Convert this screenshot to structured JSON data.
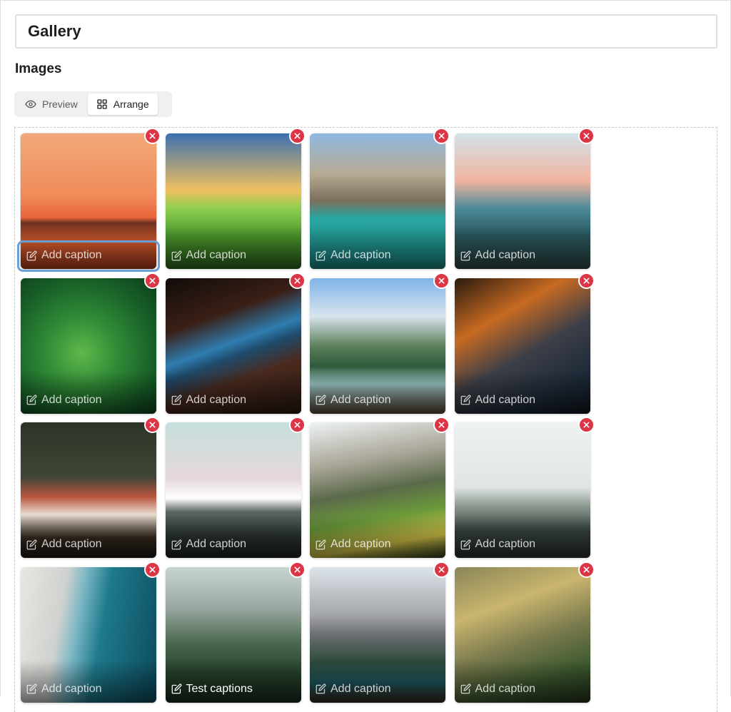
{
  "gallery": {
    "title": "Gallery",
    "section_heading": "Images"
  },
  "mode_toggle": {
    "preview_label": "Preview",
    "arrange_label": "Arrange",
    "active": "arrange"
  },
  "colors": {
    "remove": "#dc3545",
    "focus_ring": "#6aa0d8"
  },
  "images": [
    {
      "caption": "",
      "placeholder": "Add caption",
      "selected": true,
      "bg": "linear-gradient(180deg,#f2a87a 0%,#f08c5a 45%,#e9653b 62%,#6a2f1f 66%,#e0602e 80%,#b04020 100%)"
    },
    {
      "caption": "",
      "placeholder": "Add caption",
      "bg": "linear-gradient(180deg,#3c6fb0 0%,#f0c060 42%,#8fcf50 55%,#4d9a2e 75%,#2f6b1e 100%)"
    },
    {
      "caption": "",
      "placeholder": "Add caption",
      "bg": "linear-gradient(180deg,#8fb8e0 0%,#b7aa93 30%,#7a6e5c 50%,#2aa6a0 62%,#1b8a86 100%)"
    },
    {
      "caption": "",
      "placeholder": "Add caption",
      "bg": "linear-gradient(180deg,#d3e2ea 0%,#f2b49e 35%,#4d8a9a 55%,#2a5a60 75%,#2f4848 100%)"
    },
    {
      "caption": "",
      "placeholder": "Add caption",
      "bg": "radial-gradient(circle at 45% 55%,#5fb84a 0%,#2f8a36 35%,#175e28 70%,#0d3d1a 100%)"
    },
    {
      "caption": "",
      "placeholder": "Add caption",
      "bg": "linear-gradient(160deg,#120c0a 0%,#3a1f16 30%,#2f7db0 48%,#1f4a6a 56%,#4a2a1e 70%,#2a1812 100%)"
    },
    {
      "caption": "",
      "placeholder": "Add caption",
      "bg": "linear-gradient(180deg,#7fb4e8 0%,#d8e4ee 28%,#5d7f5a 50%,#2d5a3a 65%,#9cc6c8 78%,#5a4a3a 100%)"
    },
    {
      "caption": "",
      "placeholder": "Add caption",
      "bg": "linear-gradient(150deg,#2a1a0e 0%,#c76a22 30%,#3d3f48 55%,#1e2a38 80%,#101820 100%)"
    },
    {
      "caption": "",
      "placeholder": "Add caption",
      "bg": "linear-gradient(180deg,#2d3528 0%,#3f4536 40%,#b8553e 55%,#e8ddd0 68%,#3a2e22 85%,#1e1812 100%)"
    },
    {
      "caption": "",
      "placeholder": "Add caption",
      "bg": "linear-gradient(180deg,#c6dedc 0%,#e6d8dc 42%,#ffffff 56%,#5a6460 66%,#2c3630 85%,#1c2420 100%)"
    },
    {
      "caption": "",
      "placeholder": "Add caption",
      "bg": "linear-gradient(170deg,#eef3f5 0%,#a8a496 30%,#5b6a4a 50%,#6a9a3a 68%,#d8c84a 85%,#2a3a1e 100%)"
    },
    {
      "caption": "",
      "placeholder": "Add caption",
      "bg": "linear-gradient(180deg,#eef2f0 0%,#dfe6e2 48%,#8a968e 62%,#3a4640 80%,#2a3430 100%)"
    },
    {
      "caption": "",
      "placeholder": "Add caption",
      "bg": "linear-gradient(100deg,#e8e6e2 0%,#cfd2cf 30%,#7ab6c4 42%,#1d7a8c 58%,#0d4a5c 100%)"
    },
    {
      "caption": "Test captions",
      "placeholder": "Add caption",
      "bg": "linear-gradient(180deg,#c8d4d0 0%,#9aa8a2 30%,#4d6a50 55%,#26422c 78%,#1a2c1e 100%)"
    },
    {
      "caption": "",
      "placeholder": "Add caption",
      "bg": "linear-gradient(180deg,#dce4ea 0%,#a4a6aa 35%,#6a6e72 50%,#2e4a3a 70%,#1e5a60 85%,#3a2a22 100%)"
    },
    {
      "caption": "",
      "placeholder": "Add caption",
      "bg": "linear-gradient(160deg,#8a8658 0%,#c9b56e 30%,#7a7a4e 55%,#3f5a30 78%,#24341c 100%)"
    }
  ]
}
